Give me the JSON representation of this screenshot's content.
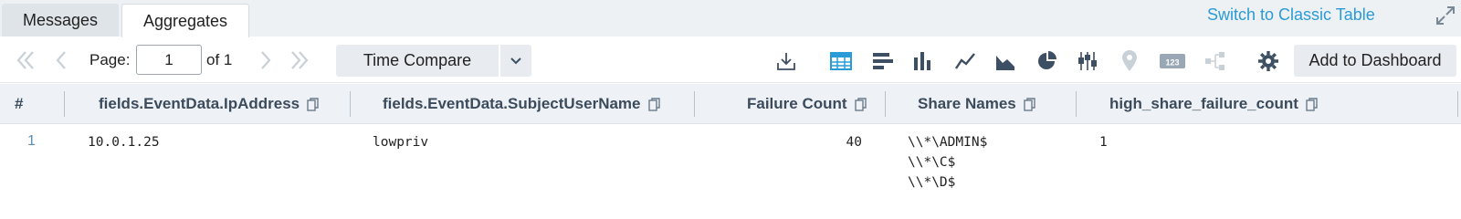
{
  "tabs": [
    {
      "label": "Messages",
      "active": false
    },
    {
      "label": "Aggregates",
      "active": true
    }
  ],
  "header": {
    "switch_link": "Switch to Classic Table",
    "expand_icon": "expand-icon"
  },
  "pagination": {
    "page_label": "Page:",
    "page_value": "1",
    "of_label": "of 1"
  },
  "toolbar": {
    "time_compare": "Time Compare",
    "add_to_dashboard": "Add to Dashboard",
    "icons": [
      "download-icon",
      "table-icon",
      "bar-chart-horizontal-icon",
      "column-chart-icon",
      "line-chart-icon",
      "area-chart-icon",
      "pie-chart-icon",
      "box-plot-icon",
      "map-pin-icon",
      "single-value-icon",
      "flow-icon",
      "gear-icon"
    ]
  },
  "table": {
    "columns": [
      "#",
      "fields.EventData.IpAddress",
      "fields.EventData.SubjectUserName",
      "Failure Count",
      "Share Names",
      "high_share_failure_count"
    ],
    "rows": [
      {
        "num": "1",
        "ip": "10.0.1.25",
        "user": "lowpriv",
        "failure_count": "40",
        "share_names": [
          "\\\\*\\ADMIN$",
          "\\\\*\\C$",
          "\\\\*\\D$"
        ],
        "high_share_failure_count": "1"
      }
    ]
  },
  "colors": {
    "accent": "#2a9bd6",
    "header_bg": "#eef2f6",
    "tab_bg": "#eef1f4",
    "button_bg": "#e8ebef",
    "icon_active": "#2a9bd6",
    "icon": "#3d4f63",
    "icon_disabled": "#c8d0d8"
  }
}
